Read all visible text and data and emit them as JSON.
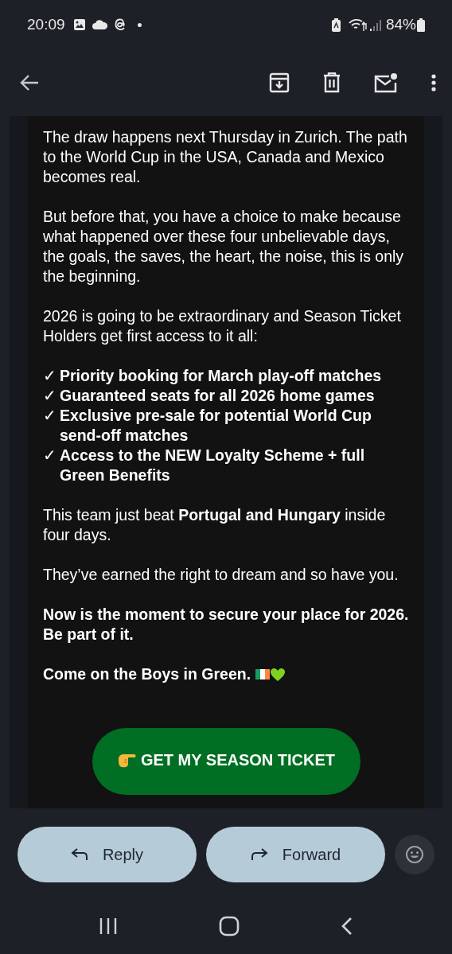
{
  "status_bar": {
    "time": "20:09",
    "battery": "84%"
  },
  "paragraphs": [
    {
      "kind": "text",
      "text": "The draw happens next Thursday in Zurich. The path to the World Cup in the USA, Canada and Mexico becomes real."
    },
    {
      "kind": "text",
      "text": "But before that, you have a choice to make because what happened over these four unbelievable days, the goals, the saves, the heart, the noise, this is only the beginning."
    },
    {
      "kind": "text",
      "text": "2026 is going to be extraordinary and Season Ticket Holders get first access to it all:"
    },
    {
      "kind": "checklist",
      "items": [
        {
          "mark": "✓",
          "text": "Priority booking for March play-off matches"
        },
        {
          "mark": "✓",
          "text": "Guaranteed seats for all 2026 home games"
        },
        {
          "mark": "✓",
          "text": "Exclusive pre-sale for potential World Cup send-off matches"
        },
        {
          "mark": "✓",
          "text": "Access to the NEW Loyalty Scheme + full Green Benefits"
        }
      ]
    },
    {
      "kind": "text",
      "text": "This team just beat **Portugal and Hungary** inside four days."
    },
    {
      "kind": "text",
      "text": "They’ve earned the right to dream and so have you."
    },
    {
      "kind": "bold",
      "text": "Now is the moment to secure your place for 2026. Be part of it."
    },
    {
      "kind": "closing",
      "text": "Come on the Boys in Green."
    }
  ],
  "cta_button": {
    "label": "GET MY SEASON TICKET"
  },
  "actions": [
    {
      "kind": "reply",
      "label": "Reply"
    },
    {
      "kind": "forward",
      "label": "Forward"
    }
  ]
}
